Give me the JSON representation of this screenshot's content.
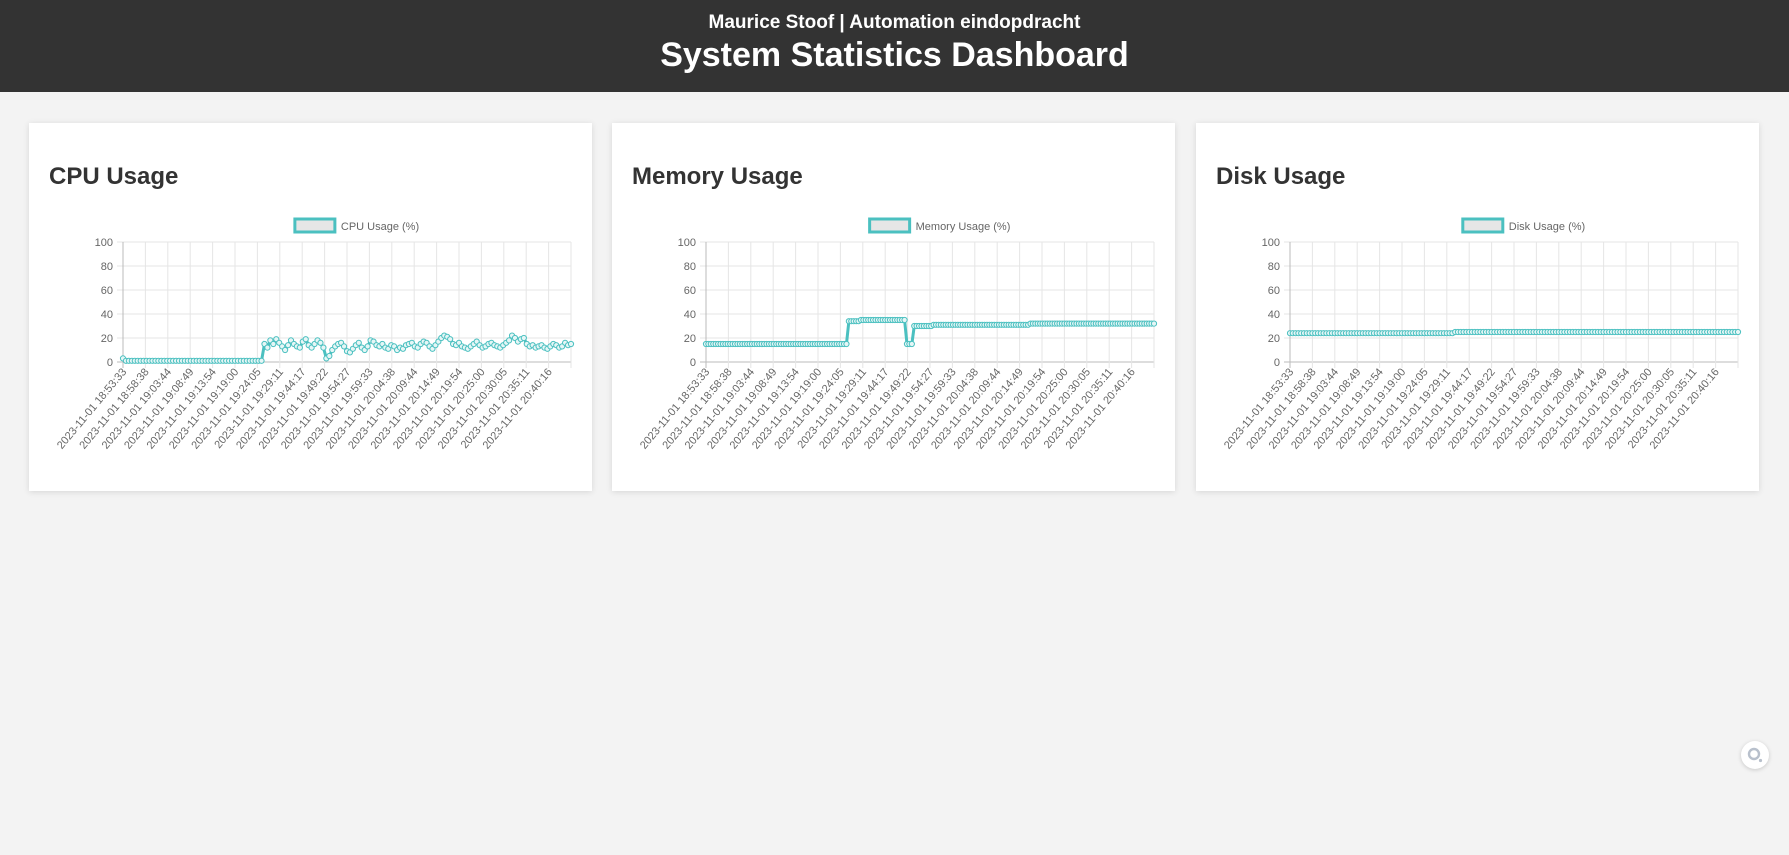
{
  "header": {
    "subtitle": "Maurice Stoof | Automation eindopdracht",
    "title": "System Statistics Dashboard"
  },
  "colors": {
    "header_bg": "#333333",
    "page_bg": "#f3f3f3",
    "line": "#4bc0c0",
    "legend_fill": "#e6e6e6"
  },
  "floating_button_icon": "search-icon",
  "cards": [
    {
      "title": "CPU Usage"
    },
    {
      "title": "Memory Usage"
    },
    {
      "title": "Disk Usage"
    }
  ],
  "chart_data": [
    {
      "type": "line",
      "title": "CPU Usage",
      "legend": "CPU Usage (%)",
      "legend_position": "top",
      "grid": true,
      "ylim": [
        0,
        100
      ],
      "yticks": [
        0,
        20,
        40,
        60,
        80,
        100
      ],
      "x_tick_labels": [
        "2023-11-01 18:53:33",
        "2023-11-01 18:58:38",
        "2023-11-01 19:03:44",
        "2023-11-01 19:08:49",
        "2023-11-01 19:13:54",
        "2023-11-01 19:19:00",
        "2023-11-01 19:24:05",
        "2023-11-01 19:29:11",
        "2023-11-01 19:44:17",
        "2023-11-01 19:49:22",
        "2023-11-01 19:54:27",
        "2023-11-01 19:59:33",
        "2023-11-01 20:04:38",
        "2023-11-01 20:09:44",
        "2023-11-01 20:14:49",
        "2023-11-01 20:19:54",
        "2023-11-01 20:25:00",
        "2023-11-01 20:30:05",
        "2023-11-01 20:35:11",
        "2023-11-01 20:40:16"
      ],
      "values": [
        3,
        1,
        1,
        1,
        1,
        1,
        1,
        1,
        1,
        1,
        1,
        1,
        1,
        1,
        1,
        1,
        1,
        1,
        1,
        1,
        1,
        1,
        1,
        1,
        1,
        1,
        1,
        1,
        1,
        1,
        1,
        1,
        1,
        1,
        1,
        1,
        1,
        1,
        1,
        1,
        1,
        1,
        1,
        1,
        1,
        1,
        1,
        1,
        15,
        12,
        18,
        15,
        19,
        16,
        13,
        10,
        14,
        18,
        15,
        13,
        12,
        17,
        19,
        14,
        12,
        15,
        18,
        16,
        12,
        3,
        5,
        10,
        13,
        15,
        16,
        13,
        9,
        8,
        11,
        14,
        16,
        12,
        10,
        13,
        18,
        17,
        14,
        13,
        15,
        12,
        11,
        14,
        13,
        10,
        12,
        11,
        14,
        15,
        16,
        13,
        12,
        15,
        17,
        16,
        13,
        11,
        14,
        17,
        20,
        22,
        21,
        19,
        15,
        14,
        16,
        13,
        12,
        11,
        13,
        15,
        17,
        14,
        12,
        13,
        15,
        16,
        14,
        13,
        12,
        14,
        16,
        18,
        22,
        20,
        17,
        19,
        20,
        15,
        13,
        14,
        12,
        13,
        14,
        12,
        11,
        13,
        15,
        14,
        12,
        13,
        16,
        14,
        15
      ],
      "series": [
        {
          "name": "CPU Usage (%)"
        }
      ]
    },
    {
      "type": "line",
      "title": "Memory Usage",
      "legend": "Memory Usage (%)",
      "legend_position": "top",
      "grid": true,
      "ylim": [
        0,
        100
      ],
      "yticks": [
        0,
        20,
        40,
        60,
        80,
        100
      ],
      "x_tick_labels": [
        "2023-11-01 18:53:33",
        "2023-11-01 18:58:38",
        "2023-11-01 19:03:44",
        "2023-11-01 19:08:49",
        "2023-11-01 19:13:54",
        "2023-11-01 19:19:00",
        "2023-11-01 19:24:05",
        "2023-11-01 19:29:11",
        "2023-11-01 19:44:17",
        "2023-11-01 19:49:22",
        "2023-11-01 19:54:27",
        "2023-11-01 19:59:33",
        "2023-11-01 20:04:38",
        "2023-11-01 20:09:44",
        "2023-11-01 20:14:49",
        "2023-11-01 20:19:54",
        "2023-11-01 20:25:00",
        "2023-11-01 20:30:05",
        "2023-11-01 20:35:11",
        "2023-11-01 20:40:16"
      ],
      "values": [
        15,
        15,
        15,
        15,
        15,
        15,
        15,
        15,
        15,
        15,
        15,
        15,
        15,
        15,
        15,
        15,
        15,
        15,
        15,
        15,
        15,
        15,
        15,
        15,
        15,
        15,
        15,
        15,
        15,
        15,
        15,
        15,
        15,
        15,
        15,
        15,
        15,
        15,
        15,
        15,
        15,
        15,
        15,
        15,
        15,
        15,
        15,
        15,
        15,
        15,
        15,
        15,
        15,
        15,
        15,
        15,
        15,
        15,
        15,
        34,
        34,
        34,
        34,
        34,
        35,
        35,
        35,
        35,
        35,
        35,
        35,
        35,
        35,
        35,
        35,
        35,
        35,
        35,
        35,
        35,
        35,
        35,
        35,
        15,
        15,
        15,
        30,
        30,
        30,
        30,
        30,
        30,
        30,
        30,
        31,
        31,
        31,
        31,
        31,
        31,
        31,
        31,
        31,
        31,
        31,
        31,
        31,
        31,
        31,
        31,
        31,
        31,
        31,
        31,
        31,
        31,
        31,
        31,
        31,
        31,
        31,
        31,
        31,
        31,
        31,
        31,
        31,
        31,
        31,
        31,
        31,
        31,
        31,
        31,
        32,
        32,
        32,
        32,
        32,
        32,
        32,
        32,
        32,
        32,
        32,
        32,
        32,
        32,
        32,
        32,
        32,
        32,
        32,
        32,
        32,
        32,
        32,
        32,
        32,
        32,
        32,
        32,
        32,
        32,
        32,
        32,
        32,
        32,
        32,
        32,
        32,
        32,
        32,
        32,
        32,
        32,
        32,
        32,
        32,
        32,
        32,
        32,
        32,
        32,
        32,
        32
      ],
      "series": [
        {
          "name": "Memory Usage (%)"
        }
      ]
    },
    {
      "type": "line",
      "title": "Disk Usage",
      "legend": "Disk Usage (%)",
      "legend_position": "top",
      "grid": true,
      "ylim": [
        0,
        100
      ],
      "yticks": [
        0,
        20,
        40,
        60,
        80,
        100
      ],
      "x_tick_labels": [
        "2023-11-01 18:53:33",
        "2023-11-01 18:58:38",
        "2023-11-01 19:03:44",
        "2023-11-01 19:08:49",
        "2023-11-01 19:13:54",
        "2023-11-01 19:19:00",
        "2023-11-01 19:24:05",
        "2023-11-01 19:29:11",
        "2023-11-01 19:44:17",
        "2023-11-01 19:49:22",
        "2023-11-01 19:54:27",
        "2023-11-01 19:59:33",
        "2023-11-01 20:04:38",
        "2023-11-01 20:09:44",
        "2023-11-01 20:14:49",
        "2023-11-01 20:19:54",
        "2023-11-01 20:25:00",
        "2023-11-01 20:30:05",
        "2023-11-01 20:35:11",
        "2023-11-01 20:40:16"
      ],
      "values": [
        24,
        24,
        24,
        24,
        24,
        24,
        24,
        24,
        24,
        24,
        24,
        24,
        24,
        24,
        24,
        24,
        24,
        24,
        24,
        24,
        24,
        24,
        24,
        24,
        24,
        24,
        24,
        24,
        24,
        24,
        24,
        24,
        24,
        24,
        24,
        24,
        24,
        24,
        24,
        24,
        24,
        24,
        24,
        24,
        24,
        24,
        24,
        24,
        24,
        24,
        24,
        24,
        24,
        24,
        24,
        24,
        24,
        24,
        24,
        25,
        25,
        25,
        25,
        25,
        25,
        25,
        25,
        25,
        25,
        25,
        25,
        25,
        25,
        25,
        25,
        25,
        25,
        25,
        25,
        25,
        25,
        25,
        25,
        25,
        25,
        25,
        25,
        25,
        25,
        25,
        25,
        25,
        25,
        25,
        25,
        25,
        25,
        25,
        25,
        25,
        25,
        25,
        25,
        25,
        25,
        25,
        25,
        25,
        25,
        25,
        25,
        25,
        25,
        25,
        25,
        25,
        25,
        25,
        25,
        25,
        25,
        25,
        25,
        25,
        25,
        25,
        25,
        25,
        25,
        25,
        25,
        25,
        25,
        25,
        25,
        25,
        25,
        25,
        25,
        25,
        25,
        25,
        25,
        25,
        25,
        25,
        25,
        25,
        25,
        25,
        25,
        25,
        25,
        25,
        25,
        25,
        25,
        25,
        25,
        25,
        25
      ],
      "series": [
        {
          "name": "Disk Usage (%)"
        }
      ]
    }
  ]
}
